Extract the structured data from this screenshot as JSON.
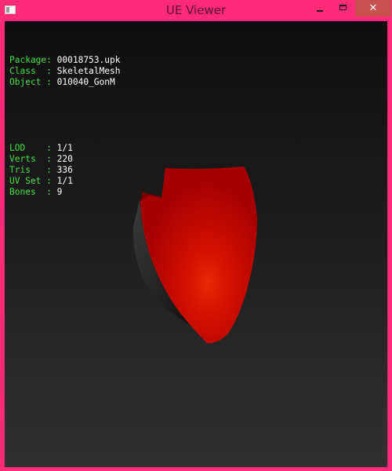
{
  "window": {
    "title": "UE Viewer",
    "controls": {
      "minimize": "",
      "maximize": "",
      "close": "✕"
    }
  },
  "info": {
    "group1": [
      {
        "key": "Package:",
        "value": "00018753.upk"
      },
      {
        "key": "Class  :",
        "value": "SkeletalMesh"
      },
      {
        "key": "Object :",
        "value": "010040_GonM"
      }
    ],
    "group2": [
      {
        "key": "LOD    :",
        "value": "1/1"
      },
      {
        "key": "Verts  :",
        "value": "220"
      },
      {
        "key": "Tris   :",
        "value": "336"
      },
      {
        "key": "UV Set :",
        "value": "1/1"
      },
      {
        "key": "Bones  :",
        "value": "9"
      }
    ]
  },
  "colors": {
    "window_border": "#ff2a78",
    "label": "#3fe03f",
    "value": "#ffffff",
    "mesh": "#d00000"
  }
}
